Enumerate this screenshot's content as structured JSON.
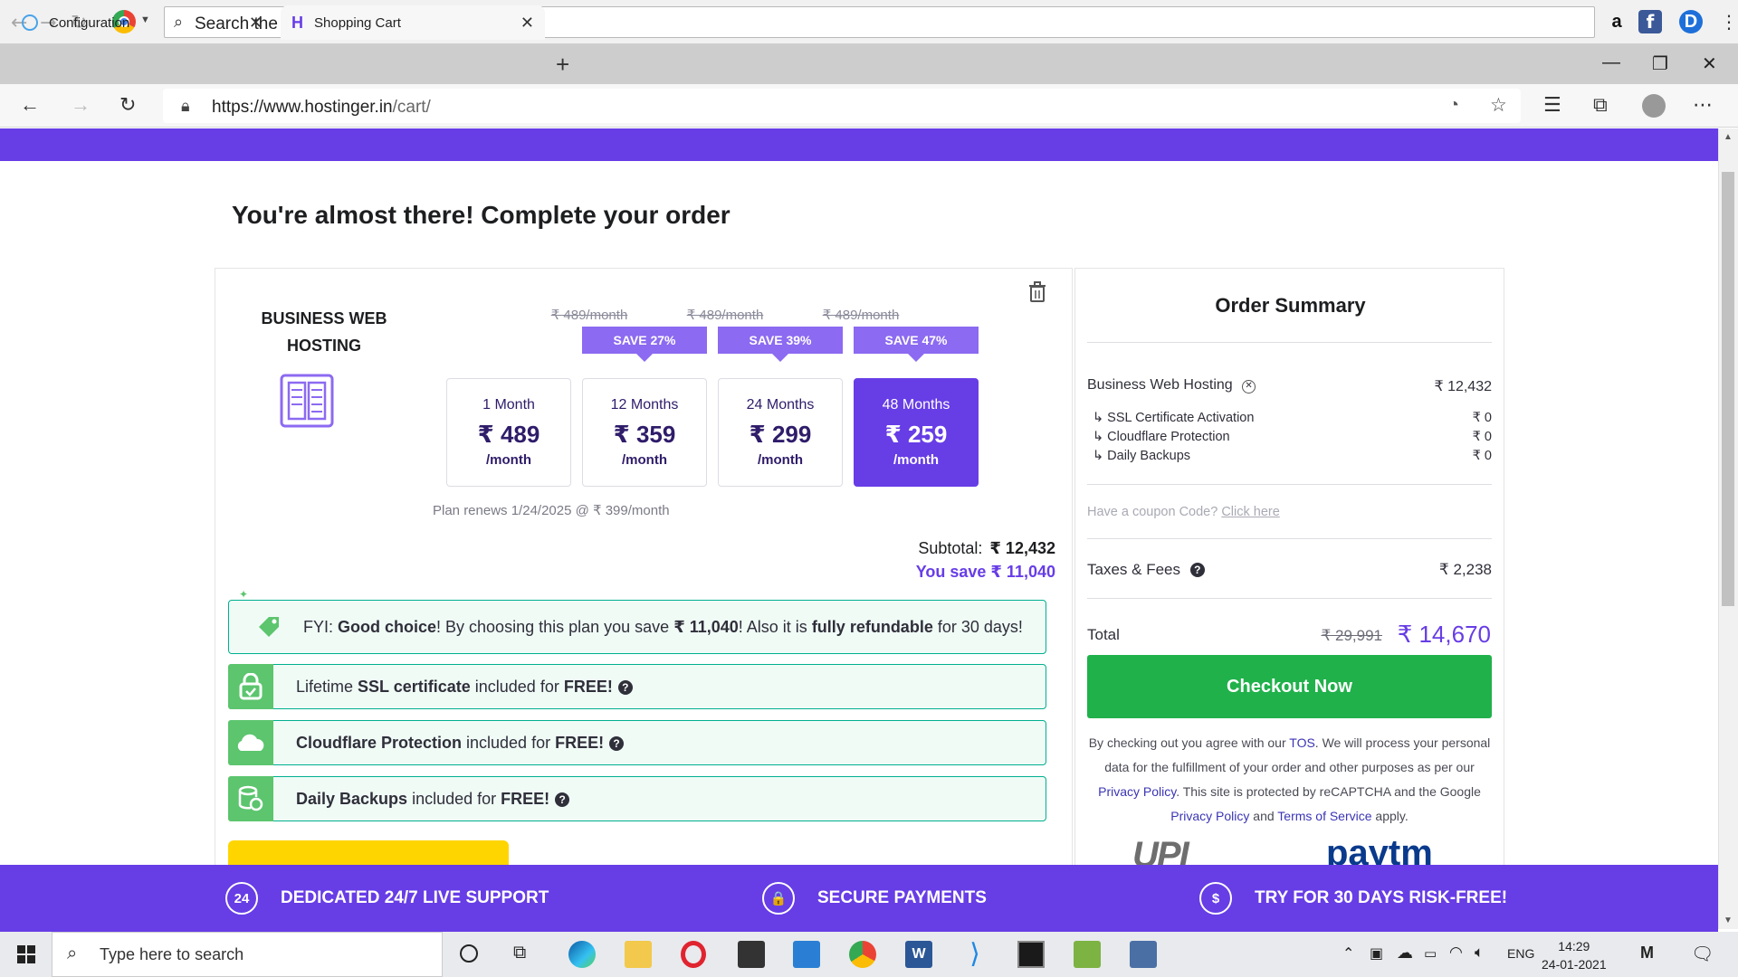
{
  "outer_toolbar": {
    "search_placeholder": "Search the web..."
  },
  "tabs": [
    {
      "label": "Configuration",
      "active": false
    },
    {
      "label": "Shopping Cart",
      "active": true
    }
  ],
  "address_bar": {
    "url_host": "https://www.hostinger.in",
    "url_path": "/cart/"
  },
  "page": {
    "heading": "You're almost there! Complete your order"
  },
  "product": {
    "name": "BUSINESS WEB HOSTING",
    "plans": [
      {
        "old_price": "",
        "save": "",
        "length": "1 Month",
        "price": "₹ 489",
        "per": "/month",
        "selected": false
      },
      {
        "old_price": "₹ 489/month",
        "save": "SAVE 27%",
        "length": "12 Months",
        "price": "₹ 359",
        "per": "/month",
        "selected": false
      },
      {
        "old_price": "₹ 489/month",
        "save": "SAVE 39%",
        "length": "24 Months",
        "price": "₹ 299",
        "per": "/month",
        "selected": false
      },
      {
        "old_price": "₹ 489/month",
        "save": "SAVE 47%",
        "length": "48 Months",
        "price": "₹ 259",
        "per": "/month",
        "selected": true
      }
    ],
    "renew_note": "Plan renews 1/24/2025 @ ₹ 399/month",
    "subtotal_label": "Subtotal:",
    "subtotal_value": "₹ 12,432",
    "you_save": "You save ₹ 11,040",
    "fyi": {
      "prefix": "FYI: ",
      "good_choice": "Good choice",
      "middle": "! By choosing this plan you save ",
      "amount": "₹ 11,040",
      "middle2": "! Also it is ",
      "refundable": "fully refundable",
      "suffix": " for 30 days!"
    },
    "features": [
      {
        "pre": "Lifetime ",
        "bold": "SSL certificate",
        "post": " included for ",
        "free": "FREE!",
        "icon": "lock-icon"
      },
      {
        "pre": "",
        "bold": "Cloudflare Protection",
        "post": " included for ",
        "free": "FREE!",
        "icon": "cloud-icon"
      },
      {
        "pre": "",
        "bold": "Daily Backups",
        "post": " included for ",
        "free": "FREE!",
        "icon": "database-icon"
      }
    ]
  },
  "summary": {
    "title": "Order Summary",
    "item_label": "Business Web Hosting",
    "item_value": "₹ 12,432",
    "sub_items": [
      {
        "label": "↳ SSL Certificate Activation",
        "value": "₹ 0"
      },
      {
        "label": "↳ Cloudflare Protection",
        "value": "₹ 0"
      },
      {
        "label": "↳ Daily Backups",
        "value": "₹ 0"
      }
    ],
    "coupon_prompt": "Have a coupon Code? ",
    "coupon_link": "Click here",
    "taxes_label": "Taxes & Fees",
    "taxes_value": "₹ 2,238",
    "total_label": "Total",
    "total_old": "₹ 29,991",
    "total_new": "₹ 14,670",
    "checkout_label": "Checkout Now",
    "tos": {
      "t1": "By checking out you agree with our ",
      "tos_link": "TOS",
      "t2": ". We will process your personal data for the fulfillment of your order and other purposes as per our ",
      "privacy_link": "Privacy Policy",
      "t3": ". This site is protected by reCAPTCHA and the Google ",
      "privacy_link2": "Privacy Policy",
      "t4": " and ",
      "terms_link": "Terms of Service",
      "t5": " apply."
    },
    "payment_logos": [
      "UPI",
      "paytm"
    ]
  },
  "band": [
    {
      "icon_text": "24",
      "label": "DEDICATED 24/7 LIVE SUPPORT"
    },
    {
      "icon_text": "🔒",
      "label": "SECURE PAYMENTS"
    },
    {
      "icon_text": "$",
      "label": "TRY FOR 30 DAYS RISK-FREE!"
    }
  ],
  "taskbar": {
    "search_placeholder": "Type here to search",
    "lang": "ENG",
    "time": "14:29",
    "date": "24-01-2021"
  },
  "colors": {
    "brand_purple": "#673de6",
    "save_purple": "#8c6af1",
    "checkout_green": "#20b14b",
    "feature_green": "#5cc56e"
  }
}
